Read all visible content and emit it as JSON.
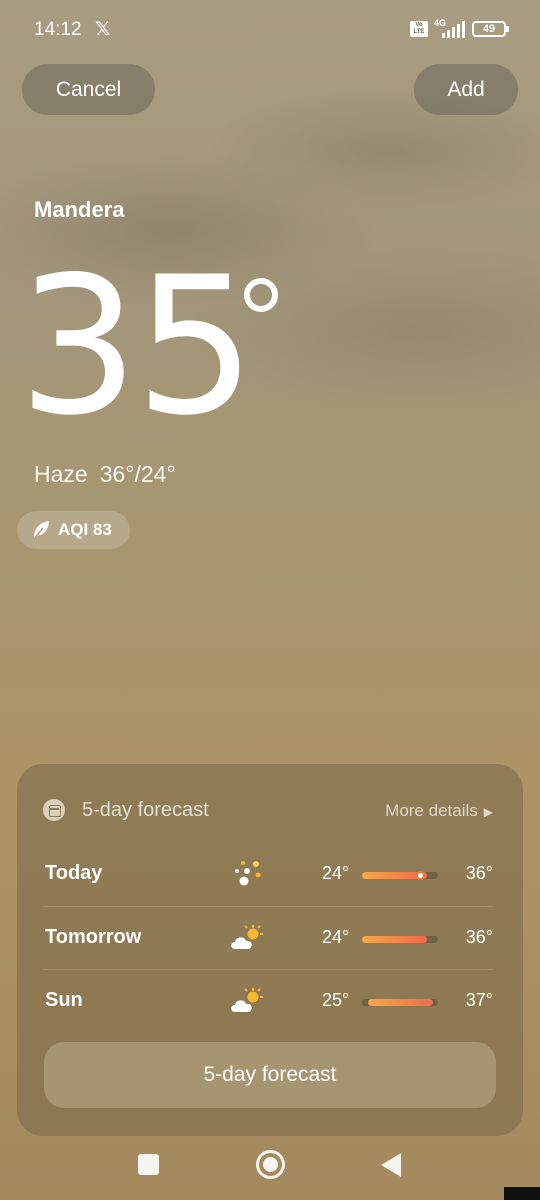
{
  "status_bar": {
    "time": "14:12",
    "x_logo": "𝕏",
    "volte": "Vo LTE",
    "network": "4G",
    "battery": "49"
  },
  "header": {
    "cancel_label": "Cancel",
    "add_label": "Add"
  },
  "weather": {
    "city": "Mandera",
    "temperature": "35",
    "condition": "Haze",
    "high_low": "36°/24°",
    "aqi": "AQI 83"
  },
  "forecast": {
    "title": "5-day forecast",
    "more_details": "More details",
    "days": [
      {
        "day": "Today",
        "icon": "sun-dust-icon",
        "low": "24°",
        "high": "36°",
        "range_start": 0.0,
        "range_end": 0.85,
        "current": 0.72
      },
      {
        "day": "Tomorrow",
        "icon": "partly-cloudy-icon",
        "low": "24°",
        "high": "36°",
        "range_start": 0.0,
        "range_end": 0.85
      },
      {
        "day": "Sun",
        "icon": "partly-cloudy-icon",
        "low": "25°",
        "high": "37°",
        "range_start": 0.08,
        "range_end": 0.93
      }
    ],
    "button_label": "5-day forecast"
  },
  "colors": {
    "bar_start": "#f4a94a",
    "bar_end": "#f06a4a",
    "sun": "#f5b82e"
  }
}
